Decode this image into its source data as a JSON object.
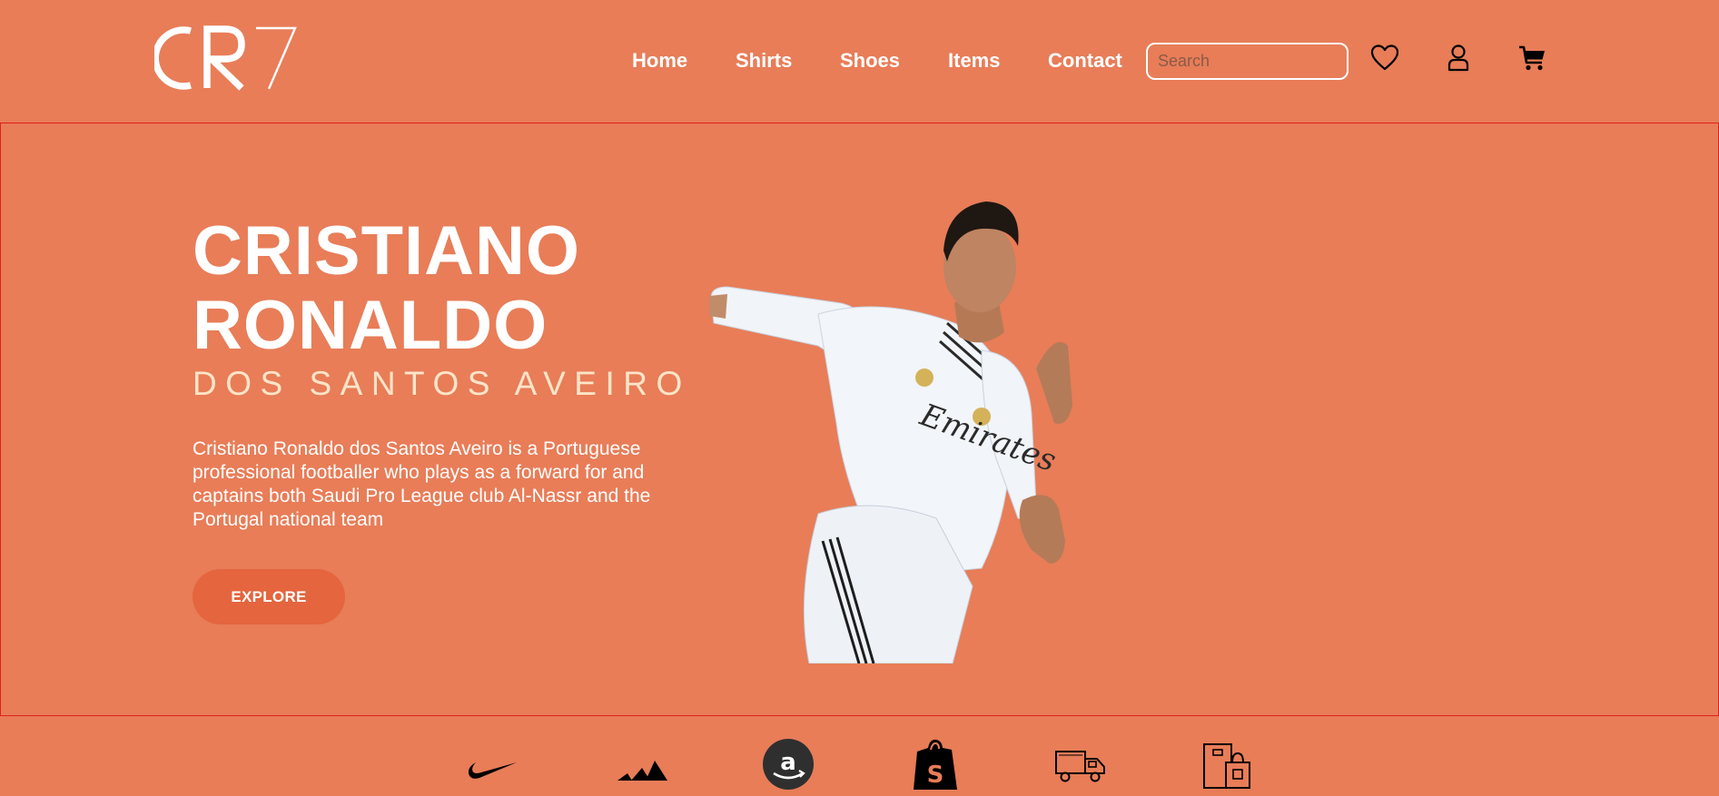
{
  "header": {
    "logo_text": "CR7",
    "nav": [
      "Home",
      "Shirts",
      "Shoes",
      "Items",
      "Contact"
    ],
    "search_placeholder": "Search",
    "icons": [
      "heart-icon",
      "user-icon",
      "cart-icon"
    ]
  },
  "hero": {
    "title_line1": "CRISTIANO",
    "title_line2": "RONALDO",
    "subtitle": "DOS SANTOS AVEIRO",
    "description": "Cristiano Ronaldo dos Santos Aveiro is a Portuguese professional footballer who plays as a forward for and captains both Saudi Pro League club Al-Nassr and the Portugal national team",
    "cta": "EXPLORE"
  },
  "brands": [
    "nike-icon",
    "adidas-icon",
    "amazon-icon",
    "shopify-icon",
    "delivery-truck-icon",
    "shopping-bags-icon"
  ],
  "colors": {
    "background": "#E87D58",
    "button": "#E4653E",
    "subtitle": "#FCE4C8",
    "hero_border": "#E0201A"
  }
}
